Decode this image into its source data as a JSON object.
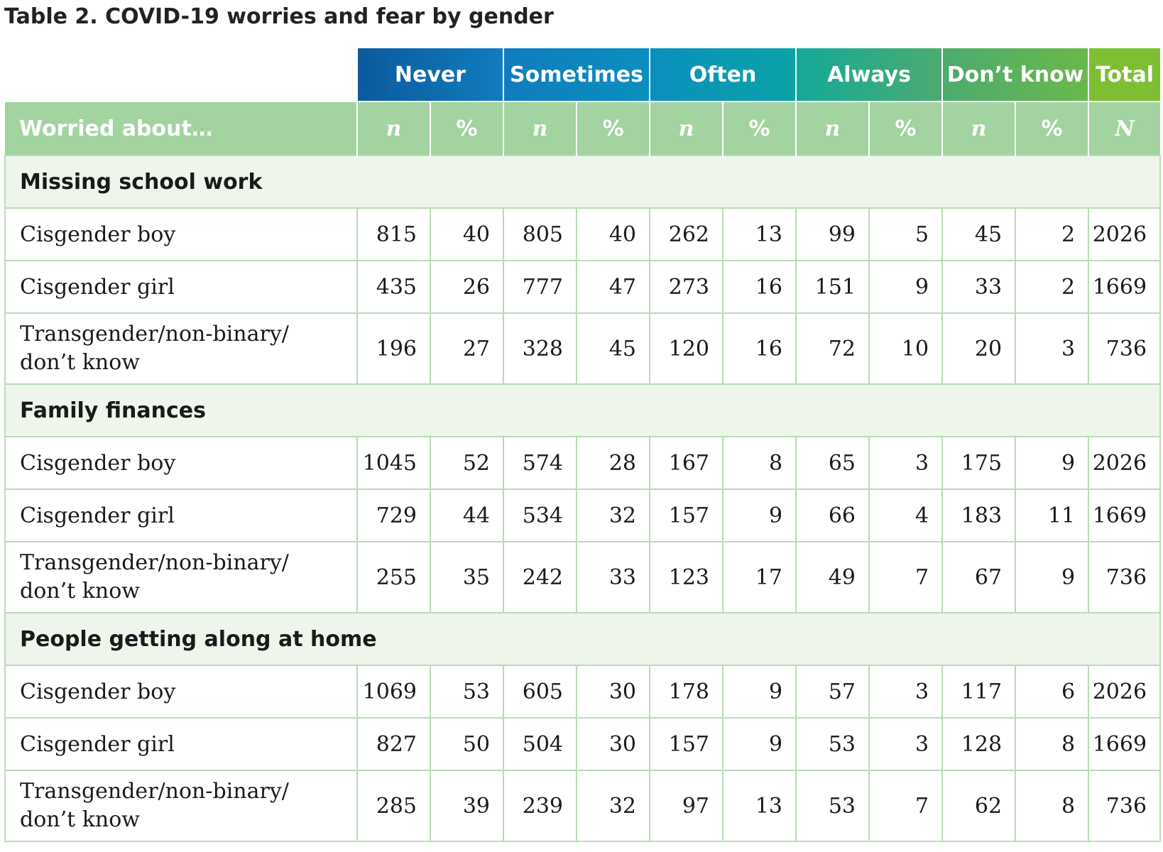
{
  "title": "Table 2. COVID-19 worries and fear by gender",
  "columns": [
    {
      "label": "Never",
      "color": "#0f6ba8"
    },
    {
      "label": "Sometimes",
      "color": "#0f7fbd"
    },
    {
      "label": "Often",
      "color": "#0aa0b0"
    },
    {
      "label": "Always",
      "color": "#2fae8e"
    },
    {
      "label": "Don’t know",
      "color": "#5fb553"
    },
    {
      "label": "Total",
      "color": "#7ec242"
    }
  ],
  "subheader": {
    "label": "Worried about…",
    "cols": [
      "n",
      "%",
      "n",
      "%",
      "n",
      "%",
      "n",
      "%",
      "n",
      "%",
      "N"
    ]
  },
  "sections": [
    {
      "title": "Missing school work",
      "rows": [
        {
          "label": "Cisgender boy",
          "values": [
            "815",
            "40",
            "805",
            "40",
            "262",
            "13",
            "99",
            "5",
            "45",
            "2",
            "2026"
          ]
        },
        {
          "label": "Cisgender girl",
          "values": [
            "435",
            "26",
            "777",
            "47",
            "273",
            "16",
            "151",
            "9",
            "33",
            "2",
            "1669"
          ]
        },
        {
          "label": "Transgender/non-binary/ don’t know",
          "values": [
            "196",
            "27",
            "328",
            "45",
            "120",
            "16",
            "72",
            "10",
            "20",
            "3",
            "736"
          ]
        }
      ]
    },
    {
      "title": "Family finances",
      "rows": [
        {
          "label": "Cisgender boy",
          "values": [
            "1045",
            "52",
            "574",
            "28",
            "167",
            "8",
            "65",
            "3",
            "175",
            "9",
            "2026"
          ]
        },
        {
          "label": "Cisgender girl",
          "values": [
            "729",
            "44",
            "534",
            "32",
            "157",
            "9",
            "66",
            "4",
            "183",
            "11",
            "1669"
          ]
        },
        {
          "label": "Transgender/non-binary/ don’t know",
          "values": [
            "255",
            "35",
            "242",
            "33",
            "123",
            "17",
            "49",
            "7",
            "67",
            "9",
            "736"
          ]
        }
      ]
    },
    {
      "title": "People getting along at home",
      "rows": [
        {
          "label": "Cisgender boy",
          "values": [
            "1069",
            "53",
            "605",
            "30",
            "178",
            "9",
            "57",
            "3",
            "117",
            "6",
            "2026"
          ]
        },
        {
          "label": "Cisgender girl",
          "values": [
            "827",
            "50",
            "504",
            "30",
            "157",
            "9",
            "53",
            "3",
            "128",
            "8",
            "1669"
          ]
        },
        {
          "label": "Transgender/non-binary/ don’t know",
          "values": [
            "285",
            "39",
            "239",
            "32",
            "97",
            "13",
            "53",
            "7",
            "62",
            "8",
            "736"
          ]
        }
      ]
    }
  ]
}
